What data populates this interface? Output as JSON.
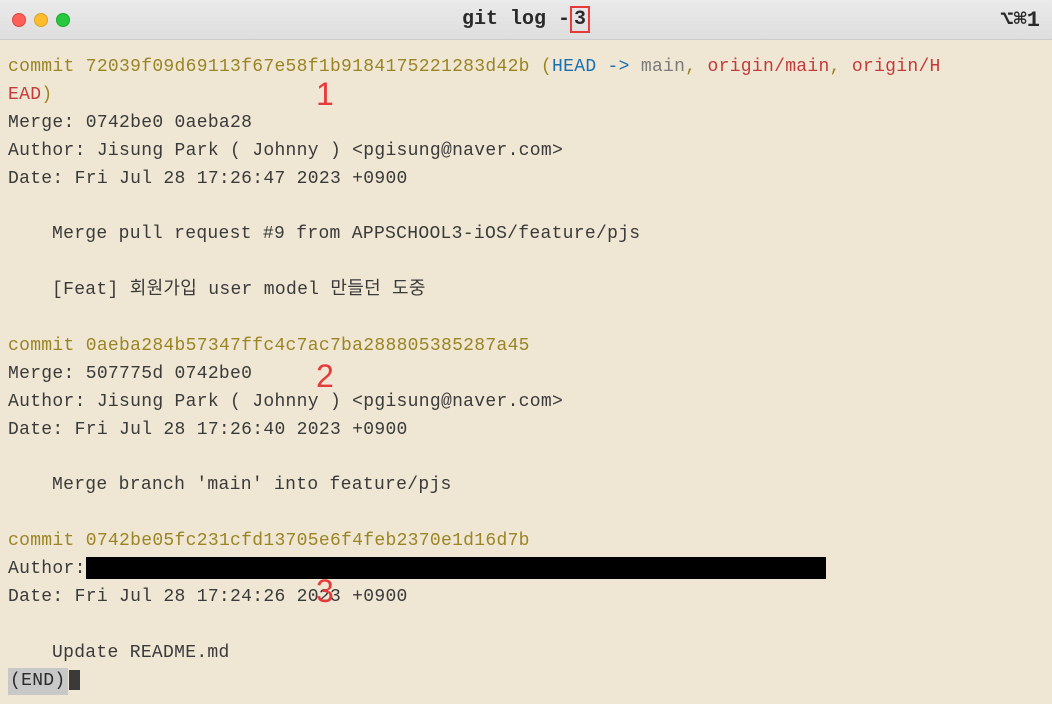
{
  "titleBar": {
    "titlePrefix": "git log -",
    "titleHighlight": "3",
    "shortcut": "⌥⌘1"
  },
  "annotations": {
    "n1": "1",
    "n2": "2",
    "n3": "3"
  },
  "commits": [
    {
      "hashLabel": "commit ",
      "hash": "72039f09d69113f67e58f1b9184175221283d42b",
      "refs": {
        "open": " (",
        "head": "HEAD -> ",
        "main": "main",
        "sep1": ", ",
        "origin1": "origin/main",
        "sep2": ", ",
        "origin2": "origin/H",
        "origin2b": "EAD",
        "close": ")"
      },
      "merge": "Merge: 0742be0 0aeba28",
      "author": "Author: Jisung Park ( Johnny ) <pgisung@naver.com>",
      "date": "Date:   Fri Jul 28 17:26:47 2023 +0900",
      "msg1": "Merge pull request #9 from APPSCHOOL3-iOS/feature/pjs",
      "msg2": "[Feat] 회원가입 user model 만들던 도중"
    },
    {
      "hashLabel": "commit ",
      "hash": "0aeba284b57347ffc4c7ac7ba288805385287a45",
      "merge": "Merge: 507775d 0742be0",
      "author": "Author: Jisung Park ( Johnny ) <pgisung@naver.com>",
      "date": "Date:   Fri Jul 28 17:26:40 2023 +0900",
      "msg1": "Merge branch 'main' into feature/pjs"
    },
    {
      "hashLabel": "commit ",
      "hash": "0742be05fc231cfd13705e6f4feb2370e1d16d7b",
      "authorLabel": "Author:",
      "date": "Date:   Fri Jul 28 17:24:26 2023 +0900",
      "msg1": "Update README.md"
    }
  ],
  "endMarker": "(END)"
}
